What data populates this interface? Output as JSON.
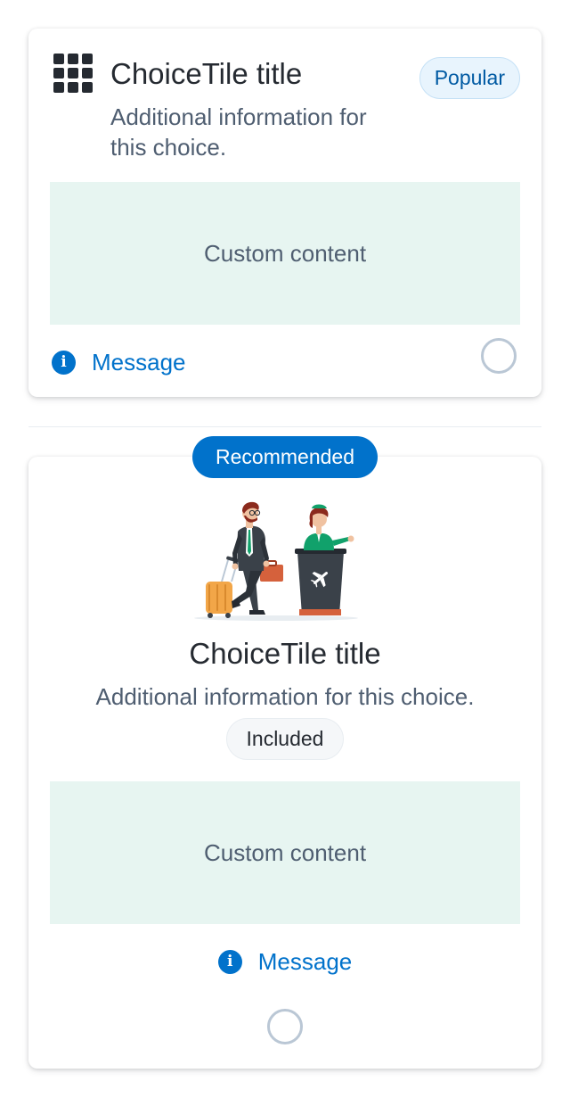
{
  "colors": {
    "accent": "#0172cb",
    "custom_content_bg": "#e7f5f1",
    "popular_badge_bg": "#e8f4fd",
    "included_badge_bg": "#f5f7f9"
  },
  "tile1": {
    "icon": "grid-icon",
    "title": "ChoiceTile title",
    "description": "Additional information for this choice.",
    "badge": "Popular",
    "custom_content": "Custom content",
    "message": "Message",
    "message_icon": "info-icon",
    "selected": false
  },
  "tile2": {
    "top_badge": "Recommended",
    "illustration": "traveler-at-airport-counter-illustration",
    "title": "ChoiceTile title",
    "description": "Additional information for this choice.",
    "badge": "Included",
    "custom_content": "Custom content",
    "message": "Message",
    "message_icon": "info-icon",
    "selected": false
  }
}
